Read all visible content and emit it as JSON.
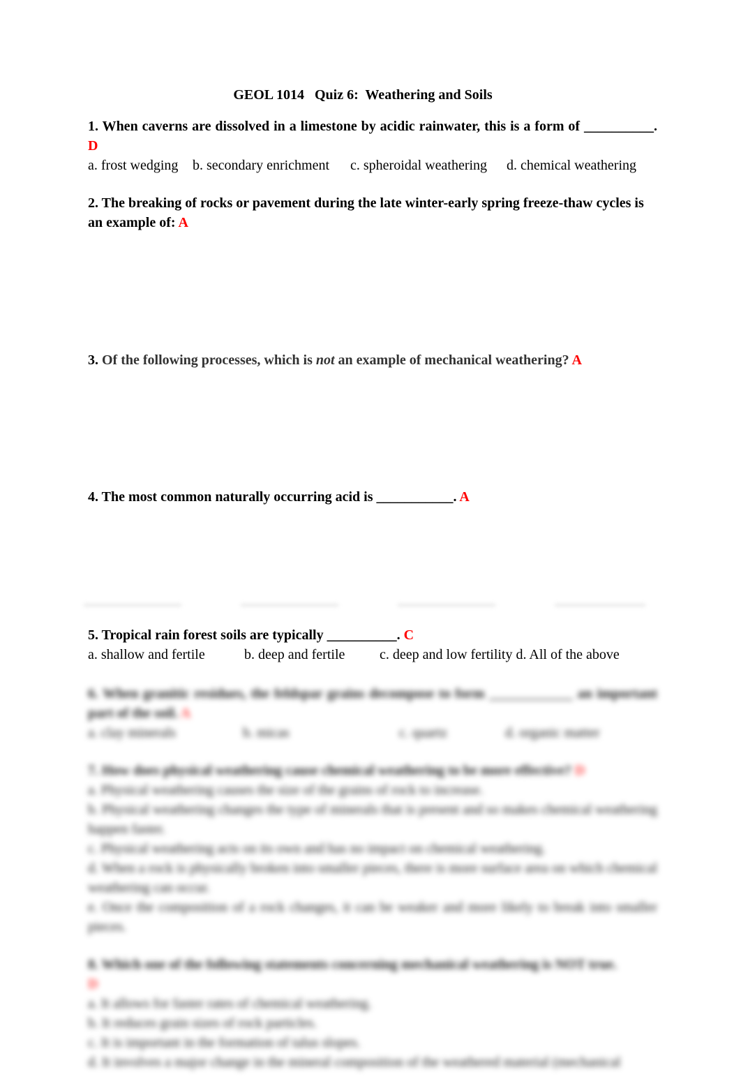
{
  "document": {
    "title": "GEOL 1014   Quiz 6:  Weathering and Soils",
    "answer_color": "#ff0000"
  },
  "questions": [
    {
      "number": "1.",
      "text": "When caverns are dissolved in a limestone by acidic rainwater, this is a form of __________.",
      "answer": "D",
      "choices": [
        "a. frost wedging",
        "b. secondary enrichment",
        "c. spheroidal weathering",
        "d. chemical weathering"
      ]
    },
    {
      "number": "2.",
      "text": "The breaking of rocks or pavement during the late winter-early spring freeze-thaw cycles is an example of:",
      "answer": "A"
    },
    {
      "number": "3.",
      "text_before": "Of the following processes, which is ",
      "text_emphasis": "not",
      "text_after": " an example of mechanical weathering?",
      "answer": "A"
    },
    {
      "number": "4.",
      "text": "The most common naturally occurring acid is ___________.",
      "answer": "A"
    },
    {
      "number": "5.",
      "text": "Tropical rain forest soils are typically __________.",
      "answer": "C",
      "choices": [
        "a. shallow and fertile",
        "b. deep and fertile",
        "c. deep and low fertility",
        "d. All of the above"
      ]
    }
  ],
  "blurred_preview": {
    "q6": {
      "text": "6. When granitic residues, the feldspar grains decompose to form ____________ an important part of the soil.",
      "answer": "A",
      "choices": [
        "a. clay minerals",
        "b. micas",
        "c. quartz",
        "d. organic matter"
      ]
    },
    "q7": {
      "text": "7. How does physical weathering cause chemical weathering to be more effective?",
      "answer": "D",
      "choices": [
        "a. Physical weathering causes the size of the grains of rock to increase.",
        "b. Physical weathering changes the type of minerals that is present and so makes chemical weathering happen faster.",
        "c. Physical weathering acts on its own and has no impact on chemical weathering.",
        "d. When a rock is physically broken into smaller pieces, there is more surface area on which chemical weathering can occur.",
        "e. Once the composition of a rock changes, it can be weaker and more likely to break into smaller pieces."
      ]
    },
    "q8": {
      "text": "8. Which one of the following statements concerning mechanical weathering is NOT true.",
      "answer": "D",
      "choices": [
        "a. It allows for faster rates of chemical weathering.",
        "b. It reduces grain sizes of rock particles.",
        "c. It is important in the formation of talus slopes.",
        "d. It involves a major change in the mineral composition of the weathered material (mechanical"
      ]
    }
  }
}
